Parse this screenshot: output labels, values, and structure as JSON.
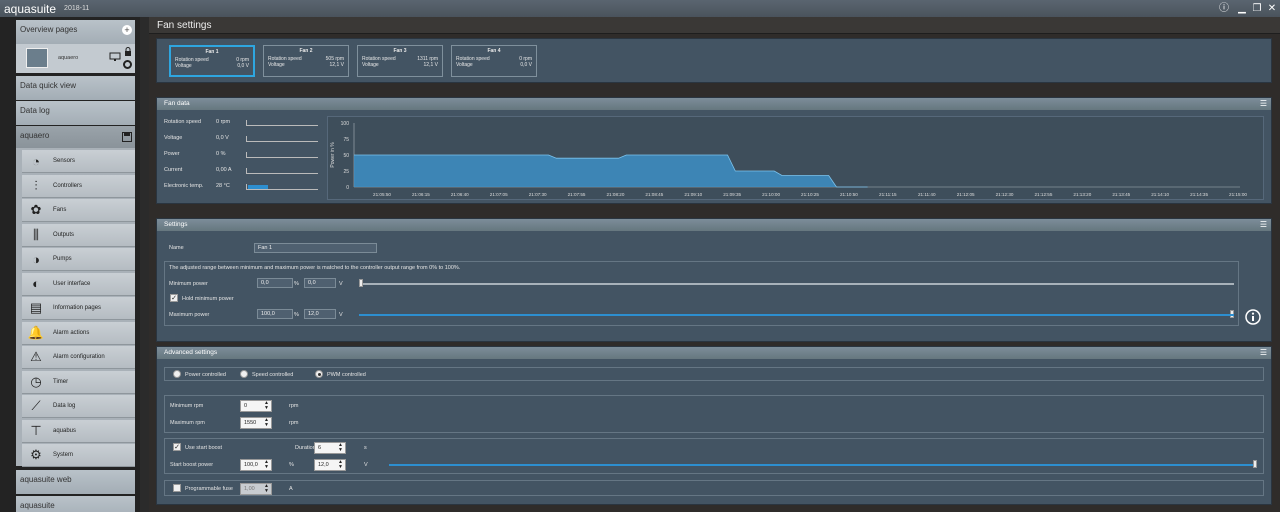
{
  "app": {
    "brand": "aquasuite",
    "version": "2018-11",
    "info_icon": "info-icon",
    "minimize_icon": "minimize-icon",
    "restore_icon": "restore-icon",
    "close_icon": "close-icon"
  },
  "sidebar": {
    "overview_pages": "Overview pages",
    "aquaero_device": "aquaero",
    "data_quick_view": "Data quick view",
    "data_log": "Data log",
    "aquaero_section": "aquaero",
    "items": [
      {
        "label": "Sensors",
        "icon": "gauge-icon"
      },
      {
        "label": "Controllers",
        "icon": "sliders-icon"
      },
      {
        "label": "Fans",
        "icon": "fan-icon"
      },
      {
        "label": "Outputs",
        "icon": "outputs-icon"
      },
      {
        "label": "Pumps",
        "icon": "pump-icon"
      },
      {
        "label": "User interface",
        "icon": "user-interface-icon"
      },
      {
        "label": "Information pages",
        "icon": "pages-icon"
      },
      {
        "label": "Alarm actions",
        "icon": "alarm-icon"
      },
      {
        "label": "Alarm configuration",
        "icon": "alarm-config-icon"
      },
      {
        "label": "Timer",
        "icon": "timer-icon"
      },
      {
        "label": "Data log",
        "icon": "chart-line-icon"
      },
      {
        "label": "aquabus",
        "icon": "network-icon"
      },
      {
        "label": "System",
        "icon": "gear-icon"
      }
    ],
    "aquasuite_web": "aquasuite web",
    "aquasuite": "aquasuite"
  },
  "page": {
    "title": "Fan settings"
  },
  "fans": [
    {
      "name": "Fan 1",
      "speed_label": "Rotation speed",
      "speed": "0 rpm",
      "voltage_label": "Voltage",
      "voltage": "0,0 V"
    },
    {
      "name": "Fan 2",
      "speed_label": "Rotation speed",
      "speed": "505 rpm",
      "voltage_label": "Voltage",
      "voltage": "12,1 V"
    },
    {
      "name": "Fan 3",
      "speed_label": "Rotation speed",
      "speed": "1311 rpm",
      "voltage_label": "Voltage",
      "voltage": "12,1 V"
    },
    {
      "name": "Fan 4",
      "speed_label": "Rotation speed",
      "speed": "0 rpm",
      "voltage_label": "Voltage",
      "voltage": "0,0 V"
    }
  ],
  "fan_data": {
    "title": "Fan data",
    "rows": [
      {
        "label": "Rotation speed",
        "value": "0 rpm",
        "level": 0
      },
      {
        "label": "Voltage",
        "value": "0,0 V",
        "level": 0
      },
      {
        "label": "Power",
        "value": "0 %",
        "level": 0
      },
      {
        "label": "Current",
        "value": "0,00 A",
        "level": 0
      },
      {
        "label": "Electronic temp.",
        "value": "28 °C",
        "level": 0.28
      }
    ]
  },
  "chart_data": {
    "type": "area",
    "ylabel": "Power in %",
    "ylim": [
      0,
      100
    ],
    "yticks": [
      "100",
      "75",
      "50",
      "25",
      "0"
    ],
    "xticks": [
      "21:05:50",
      "21:06:15",
      "21:06:40",
      "21:07:05",
      "21:07:30",
      "21:07:55",
      "21:08:20",
      "21:08:45",
      "21:09:10",
      "21:09:35",
      "21:10:00",
      "21:10:25",
      "21:10:50",
      "21:11:15",
      "21:11:40",
      "21:12:05",
      "21:12:30",
      "21:12:55",
      "21:13:20",
      "21:13:45",
      "21:14:10",
      "21:14:35",
      "21:15:00"
    ],
    "x": [
      0,
      5.0,
      5.2,
      6.8,
      7.0,
      9.6,
      9.8,
      10.8,
      11.0,
      12.2,
      12.4,
      13.2
    ],
    "y": [
      50,
      50,
      45,
      45,
      50,
      50,
      25,
      25,
      18,
      18,
      0,
      0
    ],
    "color": "#3d8fc6"
  },
  "settings": {
    "title": "Settings",
    "name_label": "Name",
    "name_value": "Fan 1",
    "note": "The adjusted range between minimum and maximum power is matched to the controller output range from 0% to 100%.",
    "min_power_label": "Minimum power",
    "min_power_pct": "0,0",
    "min_power_v": "0,0",
    "hold_min_label": "Hold minimum power",
    "max_power_label": "Maximum power",
    "max_power_pct": "100,0",
    "max_power_v": "12,0",
    "pct_unit": "%",
    "v_unit": "V",
    "min_power_level": 0,
    "max_power_level": 1
  },
  "advanced": {
    "title": "Advanced settings",
    "modes": [
      "Power controlled",
      "Speed controlled",
      "PWM controlled"
    ],
    "min_rpm_label": "Minimum rpm",
    "min_rpm": "0",
    "max_rpm_label": "Maximum rpm",
    "max_rpm": "1550",
    "rpm_unit": "rpm",
    "start_boost_label": "Use start boost",
    "duration_label": "Duration",
    "duration": "6",
    "s_unit": "s",
    "boost_power_label": "Start boost power",
    "boost_pct": "100,0",
    "boost_v": "12,0",
    "pct_unit": "%",
    "v_unit": "V",
    "boost_level": 1,
    "fuse_label": "Programmable fuse",
    "fuse_value": "1,00",
    "a_unit": "A"
  }
}
